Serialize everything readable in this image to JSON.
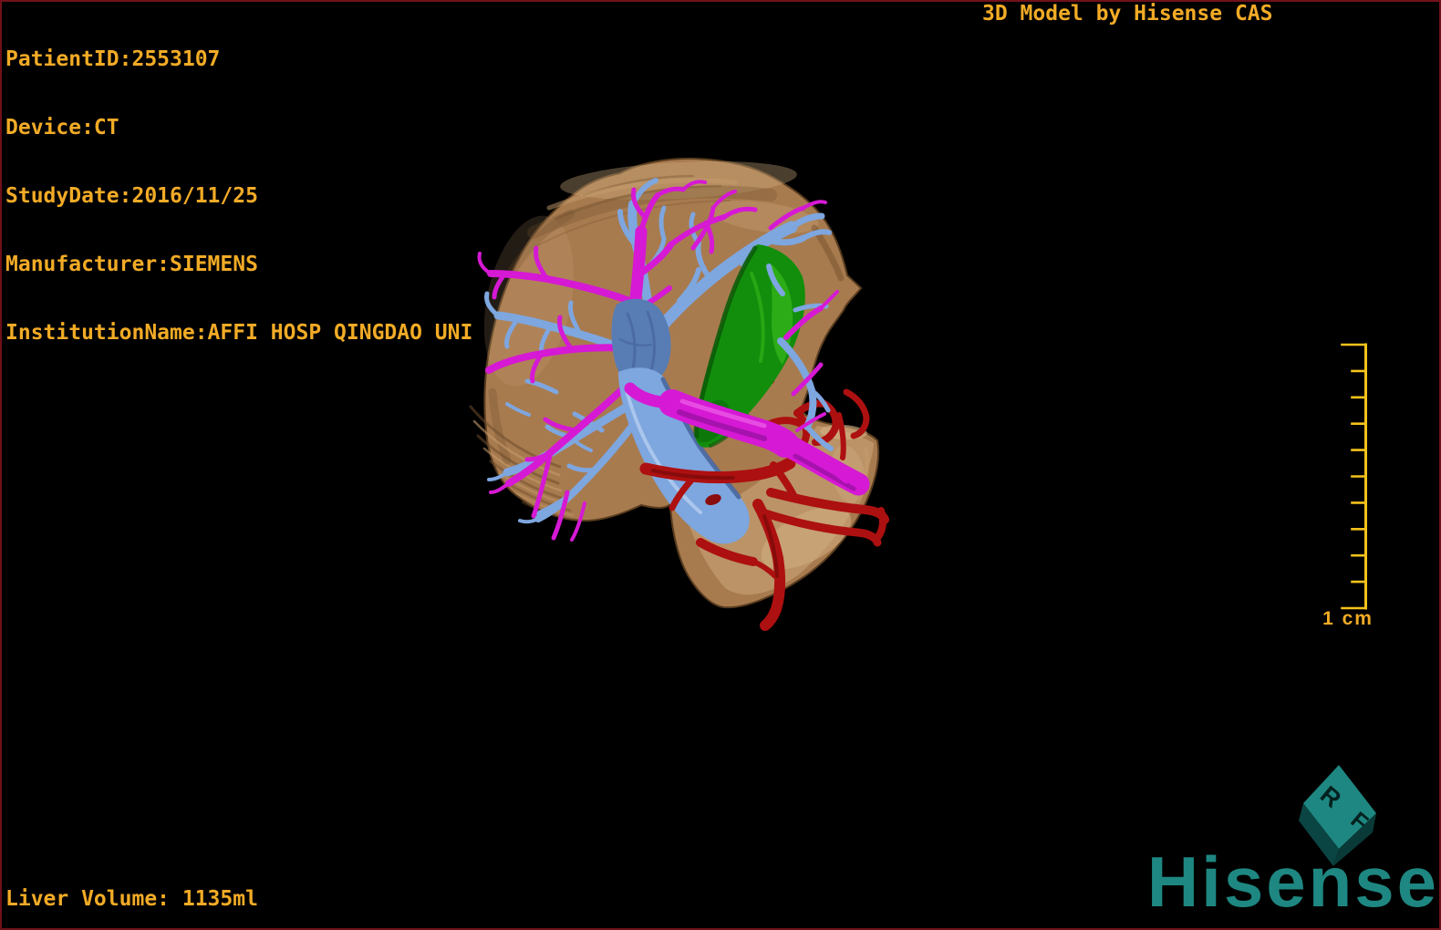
{
  "window": {
    "background": "#000000",
    "frame_color": "#70111a"
  },
  "overlay": {
    "text_color": "#f2ab26",
    "patient_info": [
      "PatientID:2553107",
      "Device:CT",
      "StudyDate:2016/11/25",
      "Manufacturer:SIEMENS",
      "InstitutionName:AFFI HOSP QINGDAO UNI"
    ],
    "watermark_title": "3D Model by Hisense CAS",
    "liver_volume": "Liver Volume: 1135ml"
  },
  "scale_bar": {
    "label": "1 cm",
    "segments": 10,
    "color": "#f6c31b"
  },
  "branding": {
    "wordmark": "Hisense",
    "cube_letter_1": "R",
    "cube_letter_2": "F",
    "color": "#1e8781",
    "cube_face_dark": "#0b4543",
    "cube_face_darker": "#093a38"
  },
  "model": {
    "colors": {
      "liver": "#a87b4f",
      "liver_light": "#d3b184",
      "liver_dark": "#6e4d2b",
      "liver_outline": "#5a3d20",
      "liver_ridge_light": "#c49b6b",
      "hepatic_vein": "#7ea6df",
      "hepatic_vein_dark": "#49679f",
      "hepatic_vein_light": "#b3cbee",
      "hub": "#587db4",
      "portal_vein": "#d619d4",
      "portal_vein_dark": "#9a10a2",
      "portal_vein_light": "#ee63e8",
      "gallbladder": "#128e0c",
      "gallbladder_light": "#3dbf1e",
      "gallbladder_dark": "#0a5c08",
      "artery": "#ad1010",
      "artery_dark": "#7c0a0a",
      "hole": "#8a0d0d"
    }
  }
}
